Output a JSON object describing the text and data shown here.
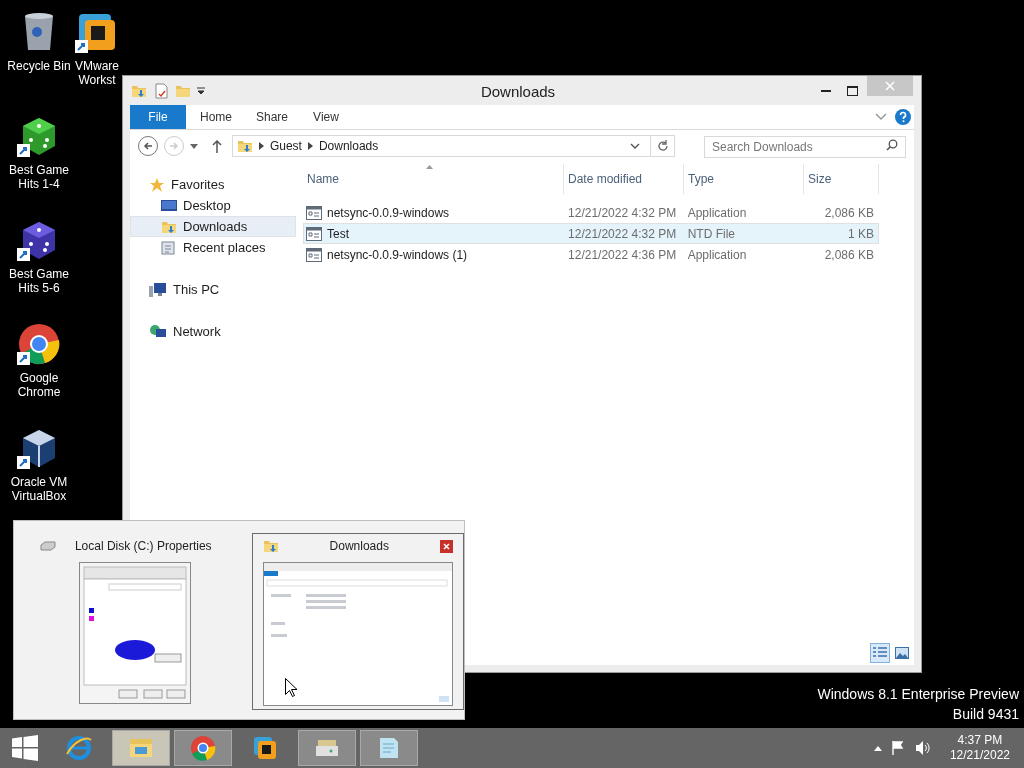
{
  "desktop_icons": [
    {
      "label": "Recycle Bin",
      "kind": "recycle"
    },
    {
      "label": "Best Game Hits 1-4",
      "kind": "dice-green"
    },
    {
      "label": "Best Game Hits 5-6",
      "kind": "dice-purple"
    },
    {
      "label": "Google Chrome",
      "kind": "chrome"
    },
    {
      "label": "Oracle VM VirtualBox",
      "kind": "virtualbox"
    },
    {
      "label": "VMware Workst",
      "kind": "vmware"
    }
  ],
  "window": {
    "title": "Downloads",
    "ribbon_tabs": [
      {
        "label": "File",
        "selected": true
      },
      {
        "label": "Home",
        "selected": false
      },
      {
        "label": "Share",
        "selected": false
      },
      {
        "label": "View",
        "selected": false
      }
    ],
    "address": [
      "Guest",
      "Downloads"
    ],
    "search": {
      "placeholder": "Search Downloads"
    },
    "nav": [
      {
        "label": "Favorites",
        "kind": "star",
        "selected": false,
        "children": [
          {
            "label": "Desktop",
            "kind": "desktop",
            "selected": false
          },
          {
            "label": "Downloads",
            "kind": "downloads",
            "selected": true
          },
          {
            "label": "Recent places",
            "kind": "recent",
            "selected": false
          }
        ]
      },
      {
        "label": "This PC",
        "kind": "pc",
        "selected": false
      },
      {
        "label": "Network",
        "kind": "network",
        "selected": false
      }
    ],
    "columns": [
      "Name",
      "Date modified",
      "Type",
      "Size"
    ],
    "rows": [
      {
        "name": "netsync-0.0.9-windows",
        "date": "12/21/2022 4:32 PM",
        "type": "Application",
        "size": "2,086 KB",
        "selected": false
      },
      {
        "name": "Test",
        "date": "12/21/2022 4:32 PM",
        "type": "NTD File",
        "size": "1 KB",
        "selected": true
      },
      {
        "name": "netsync-0.0.9-windows (1)",
        "date": "12/21/2022 4:36 PM",
        "type": "Application",
        "size": "2,086 KB",
        "selected": false
      }
    ],
    "view_buttons": [
      {
        "kind": "details",
        "selected": true
      },
      {
        "kind": "large-icons",
        "selected": false
      }
    ]
  },
  "thumbnails": [
    {
      "title": "Local Disk (C:) Properties",
      "kind": "properties",
      "selected": false
    },
    {
      "title": "Downloads",
      "kind": "explorer",
      "selected": true
    }
  ],
  "watermark": [
    "Windows 8.1 Enterprise Preview",
    "Build 9431"
  ],
  "taskbar": {
    "items": [
      {
        "kind": "ie",
        "running": false,
        "selected": false
      },
      {
        "kind": "explorer",
        "running": true,
        "selected": true
      },
      {
        "kind": "chrome",
        "running": true,
        "selected": false
      },
      {
        "kind": "vmware",
        "running": false,
        "selected": false
      },
      {
        "kind": "drive",
        "running": true,
        "selected": false
      },
      {
        "kind": "notepad",
        "running": true,
        "selected": false
      }
    ],
    "time": "4:37 PM",
    "date": "12/21/2022"
  }
}
